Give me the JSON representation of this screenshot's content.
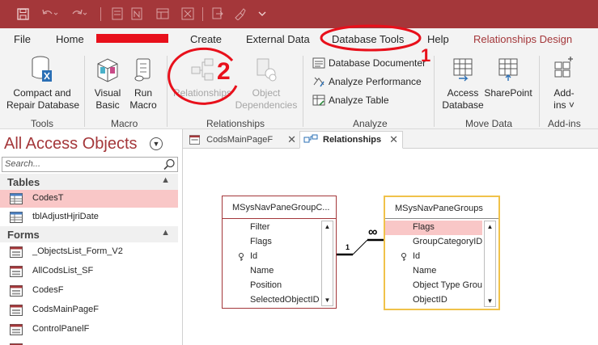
{
  "menu": {
    "file": "File",
    "home": "Home",
    "create": "Create",
    "external_data": "External Data",
    "database_tools": "Database Tools",
    "help": "Help",
    "relationships_design": "Relationships Design"
  },
  "annotations": {
    "step1": "1",
    "step2": "2"
  },
  "ribbon": {
    "compact_repair_1": "Compact and",
    "compact_repair_2": "Repair Database",
    "visual_basic_1": "Visual",
    "visual_basic_2": "Basic",
    "run_macro_1": "Run",
    "run_macro_2": "Macro",
    "relationships": "Relationships",
    "object_dependencies_1": "Object",
    "object_dependencies_2": "Dependencies",
    "database_documenter": "Database Documenter",
    "analyze_performance": "Analyze Performance",
    "analyze_table": "Analyze Table",
    "access_database_1": "Access",
    "access_database_2": "Database",
    "sharepoint": "SharePoint",
    "addins_1": "Add-",
    "addins_2": "ins",
    "groups": {
      "tools": "Tools",
      "macro": "Macro",
      "relationships": "Relationships",
      "analyze": "Analyze",
      "move_data": "Move Data",
      "addins": "Add-ins"
    }
  },
  "nav": {
    "title": "All Access Objects",
    "search_placeholder": "Search...",
    "sections": {
      "tables": "Tables",
      "forms": "Forms"
    },
    "tables": [
      "CodesT",
      "tblAdjustHjriDate"
    ],
    "forms": [
      "_ObjectsList_Form_V2",
      "AllCodsList_SF",
      "CodesF",
      "CodsMainPageF",
      "ControlPanelF"
    ]
  },
  "tabs": {
    "tab1": "CodsMainPageF",
    "tab2": "Relationships"
  },
  "diagram": {
    "table1": {
      "title": "MSysNavPaneGroupC...",
      "fields": [
        "Filter",
        "Flags",
        "Id",
        "Name",
        "Position",
        "SelectedObjectID"
      ]
    },
    "table2": {
      "title": "MSysNavPaneGroups",
      "fields": [
        "Flags",
        "GroupCategoryID",
        "Id",
        "Name",
        "Object Type Grou",
        "ObjectID"
      ]
    },
    "relation": {
      "one": "1",
      "many": "∞"
    }
  },
  "colors": {
    "accent": "#a4373a",
    "annotation": "#e8101b",
    "selected": "#f9c7c7"
  }
}
